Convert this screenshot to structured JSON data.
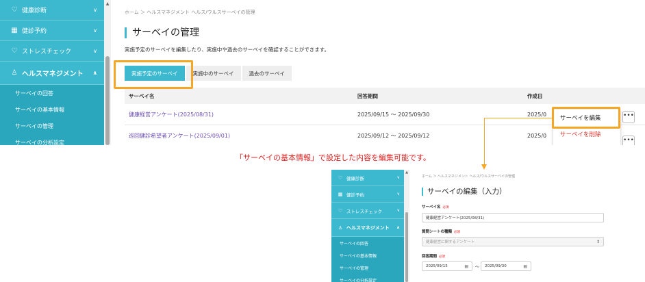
{
  "main": {
    "sidebar": {
      "items": [
        {
          "label": "健康診断",
          "icon": "stethoscope-icon",
          "glyph": "♡"
        },
        {
          "label": "健診予約",
          "icon": "calendar-icon",
          "glyph": "▦"
        },
        {
          "label": "ストレスチェック",
          "icon": "heart-icon",
          "glyph": "♡"
        },
        {
          "label": "ヘルスマネジメント",
          "icon": "person-icon",
          "glyph": "♙"
        }
      ],
      "sub_items": [
        "サーベイの回答",
        "サーベイの基本情報",
        "サーベイの管理",
        "サーベイの分析設定"
      ]
    },
    "breadcrumb": "ホーム ＞ ヘルスマネジメント ヘルス/ウルスサーベイの管理",
    "title": "サーベイの管理",
    "description": "実施予定のサーベイを編集したり、実施中や過去のサーベイを確認することができます。",
    "tabs": [
      "実施予定のサーベイ",
      "実施中のサーベイ",
      "過去のサーベイ"
    ],
    "table": {
      "headers": [
        "サーベイ名",
        "回答期間",
        "作成日"
      ],
      "rows": [
        {
          "name": "健康経営アンケート(2025/08/31)",
          "period": "2025/09/15 ～ 2025/09/30",
          "created": "2025/0"
        },
        {
          "name": "巡回健診希望者アンケート(2025/09/01)",
          "period": "2025/09/12 ～ 2025/09/12",
          "created": "2025/0"
        }
      ]
    },
    "menu": {
      "edit": "サーベイを編集",
      "delete": "サーベイを削除"
    },
    "more_label": "•••"
  },
  "caption": "「サーベイの基本情報」で設定した内容を編集可能です。",
  "sub": {
    "breadcrumb": "ホーム ＞ ヘルスマネジメント ヘルス/ウルスサーベイの管理",
    "title": "サーベイの編集（入力）",
    "fields": {
      "name_label": "サーベイ名",
      "name_value": "健康経営アンケート(2025/08/31)",
      "sheet_label": "質問シートの種類",
      "sheet_value": "健康経営に関するアンケート",
      "period_label": "回答期間",
      "start_date": "2025/09/15",
      "end_date": "2025/09/30",
      "required": "必須",
      "tilde": "～"
    }
  },
  "colors": {
    "accent": "#3cb9cf",
    "highlight": "#f5a623",
    "caption": "#e02020",
    "link": "#6a4bb5"
  }
}
